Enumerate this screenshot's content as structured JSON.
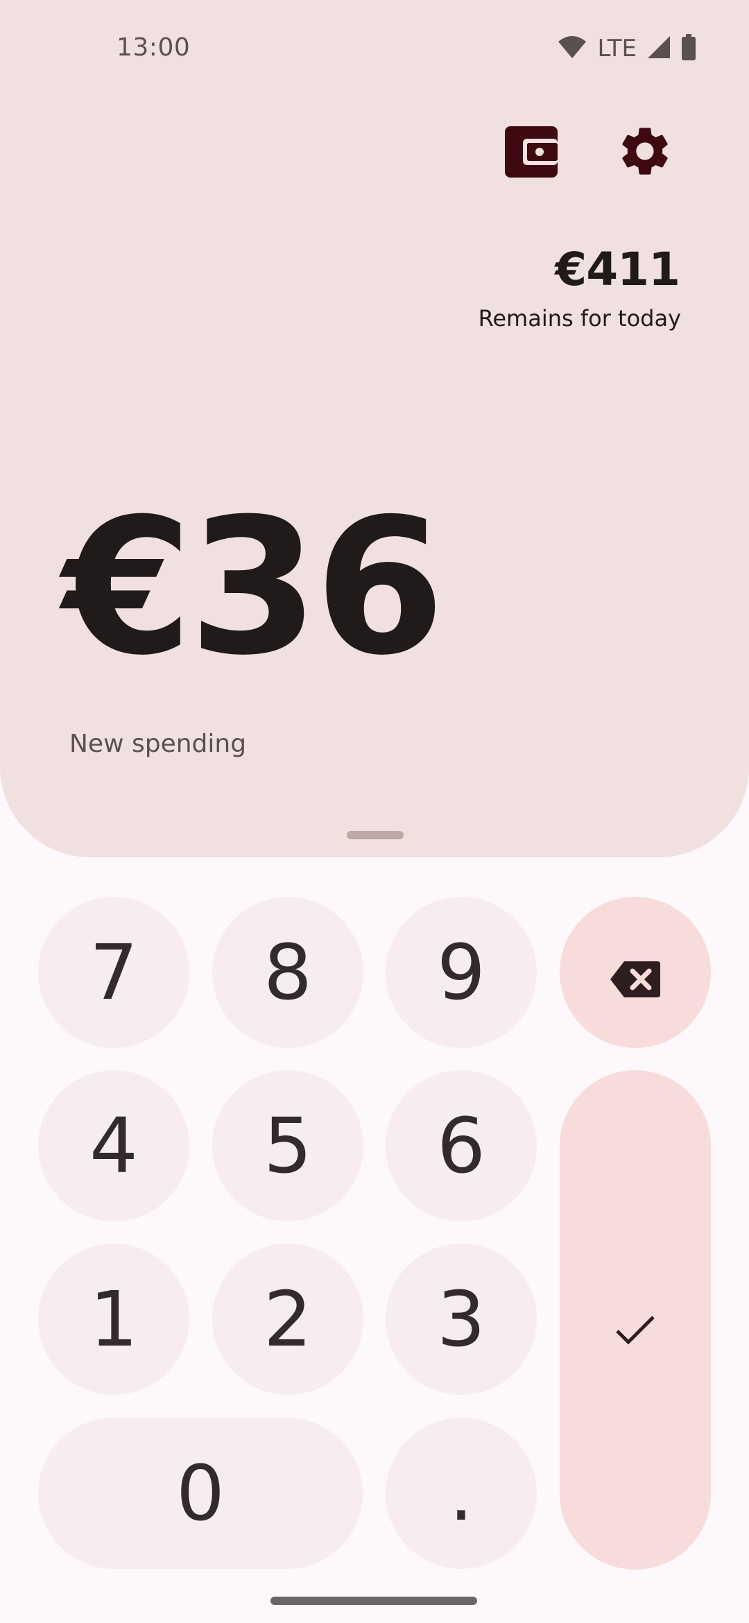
{
  "status_bar": {
    "time": "13:00",
    "network": "LTE",
    "icons": [
      "wifi-icon",
      "signal-icon",
      "battery-icon"
    ]
  },
  "toolbar": {
    "wallet_icon": "wallet-icon",
    "settings_icon": "settings-gear-icon"
  },
  "budget": {
    "remaining_amount": "€411",
    "remaining_label": "Remains for today"
  },
  "entry": {
    "amount": "€36",
    "label": "New spending"
  },
  "keypad": {
    "keys": [
      "7",
      "8",
      "9",
      "4",
      "5",
      "6",
      "1",
      "2",
      "3",
      "0",
      "."
    ],
    "backspace_icon": "backspace-icon",
    "confirm_icon": "check-icon"
  },
  "colors": {
    "panel_background": "#F0E0DF",
    "page_background": "#FCF8FB",
    "key_background": "#F8EDEE",
    "accent_key_background": "#F8DCDB",
    "icon_color": "#3E0A10",
    "text_color": "#201A1A"
  }
}
